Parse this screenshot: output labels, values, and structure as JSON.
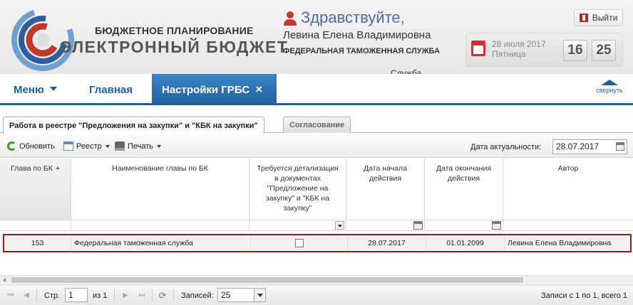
{
  "brand": {
    "top": "БЮДЖЕТНОЕ ПЛАНИРОВАНИЕ",
    "main": "ЭЛЕКТРОННЫЙ БЮДЖЕТ"
  },
  "user": {
    "greeting": "Здравствуйте,",
    "name": "Левина Елена Владимировна",
    "organization": "ФЕДЕРАЛЬНАЯ ТАМОЖЕННАЯ СЛУЖБА",
    "org_overflow": "Служба"
  },
  "exit_label": "Выйти",
  "date": {
    "date_line": "28 июля 2017",
    "weekday": "Пятница",
    "hours": "16",
    "minutes": "25"
  },
  "nav": {
    "menu": "Меню",
    "home": "Главная",
    "active_tab": "Настройки ГРБС",
    "active_tab_close": "×",
    "collapse": "свернуть"
  },
  "subtabs": {
    "active": "Работа в реестре \"Предложения на закупки\" и \"КБК на закупки\"",
    "inactive": "Согласование"
  },
  "toolbar": {
    "refresh": "Обновить",
    "registry": "Реестр",
    "print": "Печать",
    "actual_label": "Дата актуальности:",
    "actual_value": "28.07.2017"
  },
  "grid": {
    "columns": [
      "Глава по БК",
      "Наименование главы по БК",
      "Требуется детализация в документах \"Предложение на закупку\" и \"КБК на закупку\"",
      "Дата начала действия",
      "Дата окончания действия",
      "Автор"
    ],
    "rows": [
      {
        "code": "153",
        "name": "Федеральная таможенная служба",
        "detail_required": false,
        "start": "28.07.2017",
        "end": "01.01.2099",
        "author": "Левина Елена Владимировна"
      }
    ]
  },
  "pager": {
    "page_label": "Стр.",
    "page_value": "1",
    "of_label": "из 1",
    "records_label": "Записей:",
    "records_value": "25",
    "summary": "Записи с 1 по 1, всего 1"
  }
}
